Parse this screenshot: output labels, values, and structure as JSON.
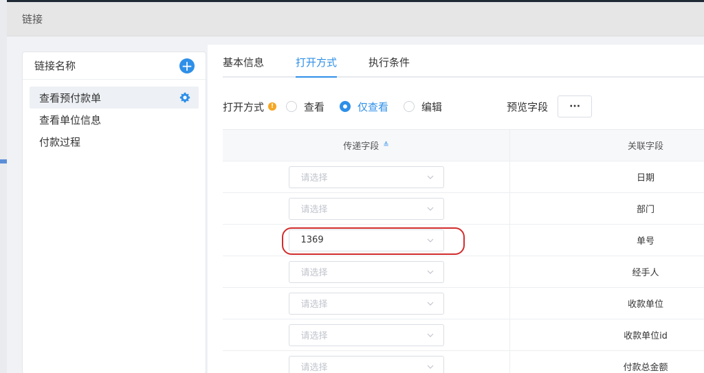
{
  "dialog": {
    "title": "链接"
  },
  "left_panel": {
    "title": "链接名称",
    "add_icon": "plus-circle-icon",
    "items": [
      {
        "label": "查看预付款单",
        "active": true,
        "icon": "gear-icon"
      },
      {
        "label": "查看单位信息",
        "active": false
      },
      {
        "label": "付款过程",
        "active": false
      }
    ]
  },
  "tabs": [
    {
      "label": "基本信息",
      "active": false
    },
    {
      "label": "打开方式",
      "active": true
    },
    {
      "label": "执行条件",
      "active": false
    }
  ],
  "open_mode": {
    "label": "打开方式",
    "info_icon": "info-icon",
    "options": [
      {
        "label": "查看",
        "checked": false
      },
      {
        "label": "仅查看",
        "checked": true
      },
      {
        "label": "编辑",
        "checked": false
      }
    ],
    "preview_label": "预览字段",
    "preview_button": "···"
  },
  "table": {
    "headers": {
      "pass_field": "传递字段",
      "related_field": "关联字段"
    },
    "sort_icon": "sort-icon",
    "placeholder": "请选择",
    "rows": [
      {
        "value": "",
        "related": "日期"
      },
      {
        "value": "",
        "related": "部门"
      },
      {
        "value": "1369",
        "related": "单号",
        "highlighted": true
      },
      {
        "value": "",
        "related": "经手人"
      },
      {
        "value": "",
        "related": "收款单位"
      },
      {
        "value": "",
        "related": "收款单位id"
      },
      {
        "value": "",
        "related": "付款总金额"
      }
    ]
  },
  "colors": {
    "accent": "#2e8fe8",
    "highlight": "#d22b2b",
    "info": "#f5a623"
  }
}
